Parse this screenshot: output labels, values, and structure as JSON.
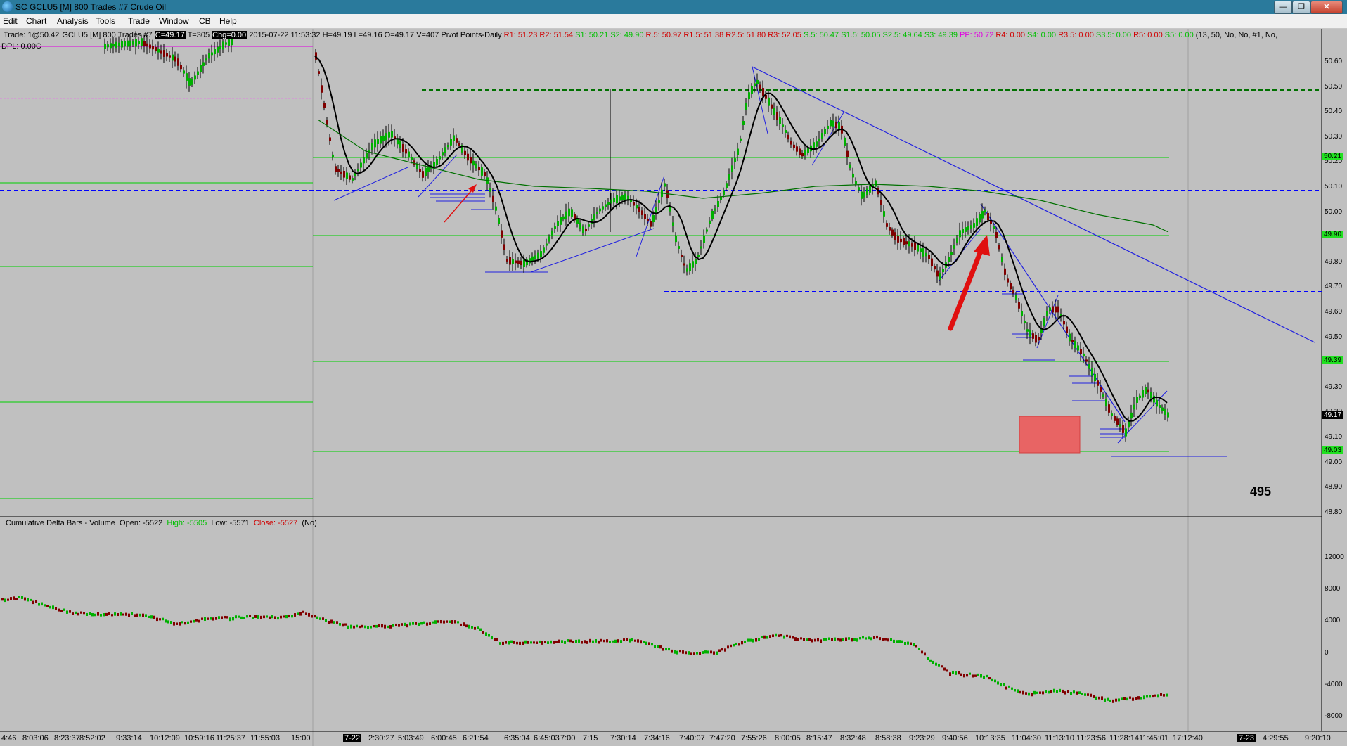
{
  "window": {
    "title": "SC GCLU5 [M]  800 Trades  #7  Crude Oil",
    "minimize_icon": "minimize-icon",
    "restore_icon": "restore-icon",
    "close_icon": "close-icon"
  },
  "menu": [
    "Edit",
    "Chart",
    "Analysis",
    "Tools",
    "Trade",
    "Window",
    "CB",
    "Help"
  ],
  "info_bar": {
    "trade": "Trade: 1@50.42",
    "symbol": "GCLU5 [M]  800 Trades  #7",
    "close": "C=49.17",
    "ticks": "T=305",
    "change": "Chg=0.00",
    "ohlc": "2015-07-22 11:53:32 H=49.19 L=49.16 O=49.17 V=407 Pivot Points-Daily",
    "pivots": [
      {
        "text": "R1: 51.23",
        "color": "#d00000"
      },
      {
        "text": "R2: 51.54",
        "color": "#d00000"
      },
      {
        "text": "S1: 50.21",
        "color": "#00c000"
      },
      {
        "text": "S2: 49.90",
        "color": "#00c000"
      },
      {
        "text": "R.5: 50.97",
        "color": "#d00000"
      },
      {
        "text": "R1.5: 51.38",
        "color": "#d00000"
      },
      {
        "text": "R2.5: 51.80",
        "color": "#d00000"
      },
      {
        "text": "R3: 52.05",
        "color": "#d00000"
      },
      {
        "text": "S.5: 50.47",
        "color": "#00c000"
      },
      {
        "text": "S1.5: 50.05",
        "color": "#00c000"
      },
      {
        "text": "S2.5: 49.64",
        "color": "#00c000"
      },
      {
        "text": "S3: 49.39",
        "color": "#00c000"
      },
      {
        "text": "PP: 50.72",
        "color": "#e000e0"
      },
      {
        "text": "R4: 0.00",
        "color": "#d00000"
      },
      {
        "text": "S4: 0.00",
        "color": "#00c000"
      },
      {
        "text": "R3.5: 0.00",
        "color": "#d00000"
      },
      {
        "text": "S3.5: 0.00",
        "color": "#00c000"
      },
      {
        "text": "R5: 0.00",
        "color": "#d00000"
      },
      {
        "text": "S5: 0.00",
        "color": "#00c000"
      }
    ],
    "params": "(13, 50, No, No, #1, No,",
    "dpl": "DPL: 0.00C"
  },
  "annotation_number": "495",
  "price_axis": {
    "labels": [
      "50.60",
      "50.50",
      "50.40",
      "50.30",
      "50.20",
      "50.10",
      "50.00",
      "49.90",
      "49.80",
      "49.70",
      "49.60",
      "49.50",
      "49.40",
      "49.30",
      "49.20",
      "49.10",
      "49.00",
      "48.90",
      "48.80"
    ],
    "current_price": "49.17",
    "green_tags": [
      "50.21",
      "49.90",
      "49.39",
      "49.03"
    ]
  },
  "delta_panel": {
    "header": "Cumulative Delta Bars - Volume",
    "open": "Open: -5522",
    "high": "High: -5505",
    "low": "Low: -5571",
    "close": "Close: -5527",
    "flag": "(No)",
    "axis_labels": [
      "12000",
      "8000",
      "4000",
      "0",
      "-4000",
      "-8000"
    ]
  },
  "time_axis": {
    "labels": [
      "4:46",
      "8:03:06",
      "8:23:37",
      "8:52:02",
      "9:33:14",
      "10:12:09",
      "10:59:16",
      "11:25:37",
      "11:55:03",
      "15:00",
      "2:30:27",
      "5:03:49",
      "6:00:45",
      "6:21:54",
      "6:35:04",
      "6:45:03",
      "7:00",
      "7:15",
      "7:30:14",
      "7:34:16",
      "7:40:07",
      "7:47:20",
      "7:55:26",
      "8:00:05",
      "8:15:47",
      "8:32:48",
      "8:58:38",
      "9:23:29",
      "9:40:56",
      "10:13:35",
      "11:04:30",
      "11:13:10",
      "11:23:56",
      "11:28:14",
      "11:45:01",
      "17:12:40",
      "4:29:55",
      "9:20:10"
    ],
    "date_markers": [
      "7-22",
      "7-23"
    ]
  },
  "colors": {
    "background": "#c0c0c0",
    "up_bar": "#00b000",
    "down_bar": "#800000",
    "ma_black": "#000000",
    "ma_green": "#007000",
    "trend_line": "#2020e0",
    "dashed_blue": "#0000ff",
    "arrow_red": "#e01010",
    "box": "#e86464"
  }
}
